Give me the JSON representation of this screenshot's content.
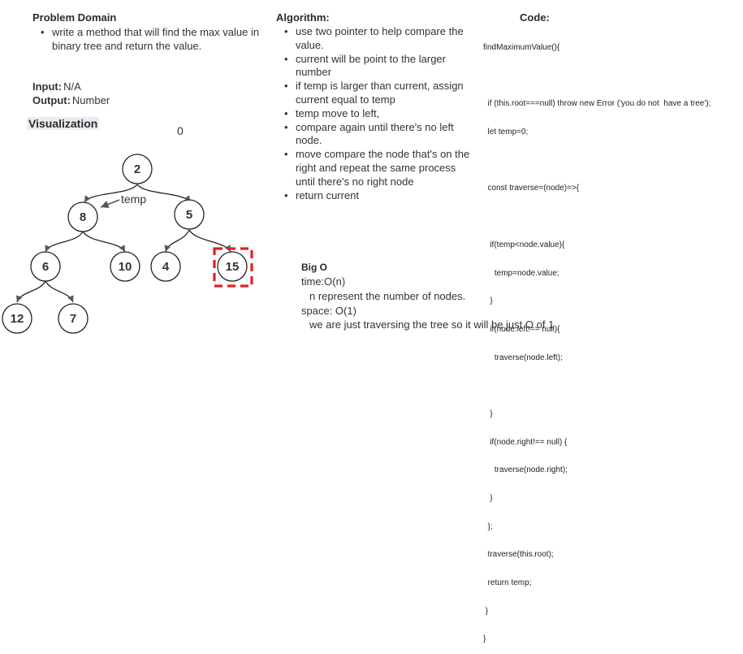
{
  "problem": {
    "heading": "Problem Domain",
    "bullets": [
      "write a method that will find the max value in binary tree and return the value."
    ],
    "input_label": "Input:",
    "input_value": "N/A",
    "output_label": "Output:",
    "output_value": "Number"
  },
  "visualization": {
    "heading": "Visualization",
    "temp_value": "0",
    "pointer_label": "temp",
    "nodes": [
      "2",
      "8",
      "5",
      "6",
      "10",
      "4",
      "15",
      "12",
      "7"
    ],
    "highlighted_node": "15",
    "highlight_color": "#e02020"
  },
  "algorithm": {
    "heading": "Algorithm:",
    "bullets": [
      "use two pointer to help compare the value.",
      "current will be point to the larger number",
      "if temp is larger than current, assign current equal to temp",
      "temp move to left,",
      "compare again until there's no left node.",
      "move compare the node that's on the right and repeat the same process until there's no right node",
      "return current"
    ]
  },
  "code": {
    "heading": "Code:",
    "lines": [
      "findMaximumValue(){",
      "",
      "  if (this.root===null) throw new Error ('you do not  have a tree');",
      "  let temp=0;",
      "",
      "  const traverse=(node)=>{",
      "",
      "   if(temp<node.value){",
      "     temp=node.value;",
      "   }",
      "   if(node.left!== null){",
      "     traverse(node.left);",
      "",
      "   }",
      "   if(node.right!== null) {",
      "     traverse(node.right);",
      "   }",
      "  };",
      "  traverse(this.root);",
      "  return temp;",
      " }",
      "}"
    ]
  },
  "bigo": {
    "heading": "Big O",
    "time_label": "time:O(n)",
    "time_note": "n represent the number of nodes.",
    "space_label": "space: O(1)",
    "space_note": "we are just traversing the tree so it will be just O of 1"
  }
}
